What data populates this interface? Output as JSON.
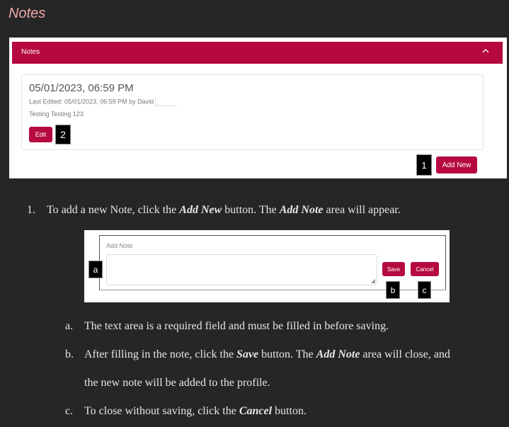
{
  "heading": "Notes",
  "screenshot1": {
    "bar_title": "Notes",
    "note": {
      "datetime": "05/01/2023, 06:59 PM",
      "last_edited": "Last Edited: 05/01/2023, 06:59 PM by David",
      "text": "Testing Testing 123"
    },
    "edit_label": "Edit",
    "add_new_label": "Add New",
    "markers": {
      "edit": "2",
      "add_new": "1"
    }
  },
  "step1": {
    "number": "1.",
    "parts": [
      "To add a new Note, click the ",
      "Add New",
      " button. The ",
      "Add Note",
      " area will appear."
    ]
  },
  "screenshot2": {
    "label": "Add Note",
    "save_label": "Save",
    "cancel_label": "Cancel",
    "markers": {
      "textarea": "a",
      "save": "b",
      "cancel": "c"
    }
  },
  "substeps": {
    "a": {
      "letter": "a.",
      "text": "The text area is a required field and must be filled in before saving."
    },
    "b": {
      "letter": "b.",
      "parts": [
        "After filling in the note, click the ",
        "Save",
        " button. The ",
        "Add Note",
        " area will close, and"
      ],
      "continuation": "the new note will be added to the profile."
    },
    "c": {
      "letter": "c.",
      "parts": [
        "To close without saving, click the ",
        "Cancel",
        " button."
      ]
    }
  }
}
